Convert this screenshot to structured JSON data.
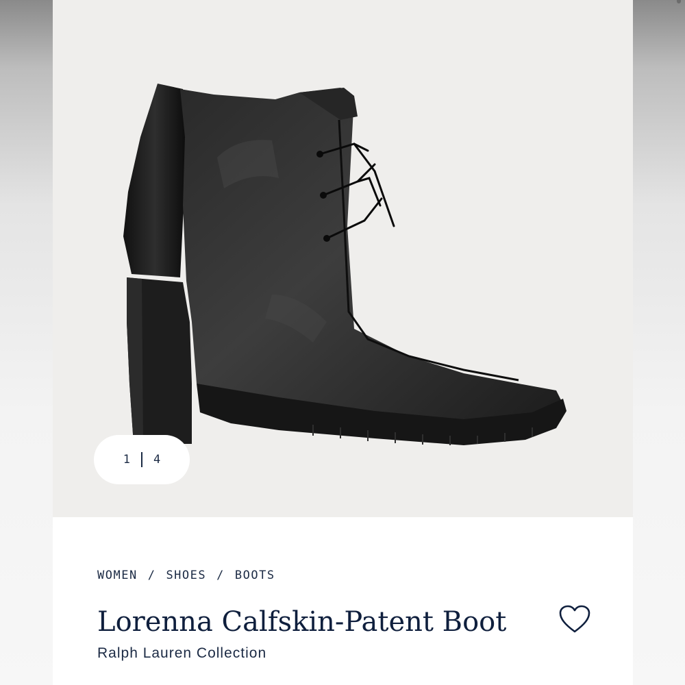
{
  "gallery": {
    "current": "1",
    "total": "4"
  },
  "breadcrumb": {
    "items": [
      "WOMEN",
      "SHOES",
      "BOOTS"
    ],
    "separator": "/"
  },
  "product": {
    "title": "Lorenna Calfskin-Patent Boot",
    "brand": "Ralph Lauren Collection"
  },
  "icons": {
    "wishlist": "heart-outline-icon"
  },
  "colors": {
    "navy": "#0f1f3d",
    "image_background": "#efeeec"
  }
}
